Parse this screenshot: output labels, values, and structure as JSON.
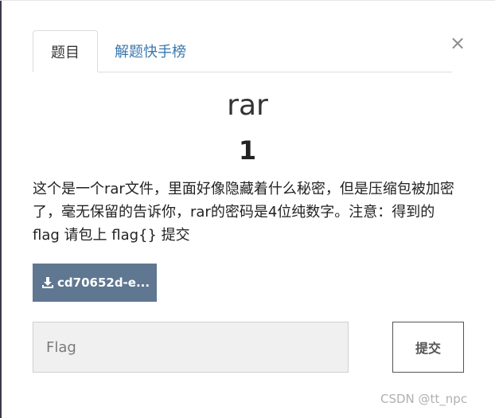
{
  "dialog": {
    "close_symbol": "×",
    "tabs": [
      {
        "label": "题目",
        "active": true
      },
      {
        "label": "解题快手榜",
        "active": false
      }
    ],
    "challenge": {
      "title": "rar",
      "points": "1",
      "description": "这个是一个rar文件，里面好像隐藏着什么秘密，但是压缩包被加密了，毫无保留的告诉你，rar的密码是4位纯数字。注意：得到的 flag 请包上 flag{} 提交",
      "download_label": "cd70652d-e..."
    },
    "flag_form": {
      "input_placeholder": "Flag",
      "input_value": "",
      "submit_label": "提交"
    }
  },
  "watermark": "CSDN @tt_npc",
  "colors": {
    "tab_link": "#3a78ae",
    "download_button": "#5f7791",
    "input_background": "#f0f0f0"
  }
}
